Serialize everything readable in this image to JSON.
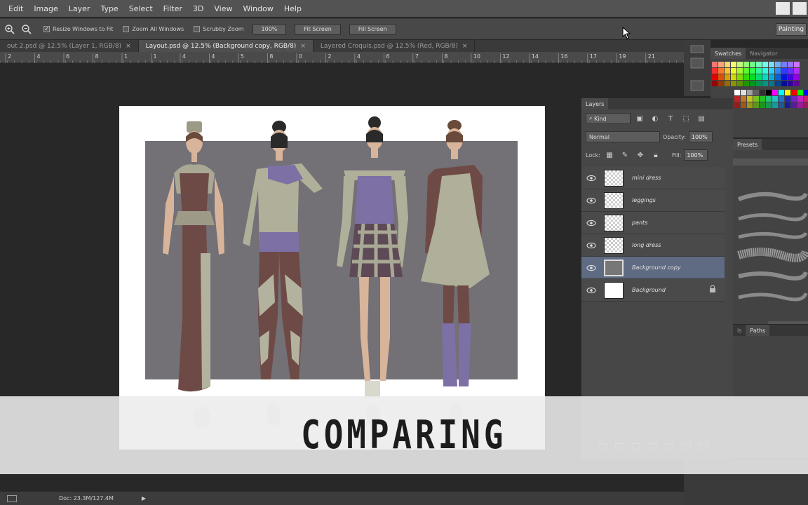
{
  "menu": {
    "items": [
      "Edit",
      "Image",
      "Layer",
      "Type",
      "Select",
      "Filter",
      "3D",
      "View",
      "Window",
      "Help"
    ]
  },
  "options_bar": {
    "resize_windows": "Resize Windows to Fit",
    "zoom_all_windows": "Zoom All Windows",
    "scrubby_zoom": "Scrubby Zoom",
    "btn_100": "100%",
    "btn_fit_screen": "Fit Screen",
    "btn_fill_screen": "Fill Screen",
    "workspace": "Painting"
  },
  "tabs": [
    {
      "label": "out 2.psd @ 12.5% (Layer 1, RGB/8)",
      "active": false
    },
    {
      "label": "Layout.psd @ 12.5% (Background copy, RGB/8)",
      "active": true
    },
    {
      "label": "Layered Croquis.psd @ 12.5% (Red, RGB/8)",
      "active": false
    }
  ],
  "ruler_numbers": [
    "2",
    "4",
    "6",
    "8",
    "1",
    "1",
    "4",
    "4",
    "5",
    "8",
    "0",
    "2",
    "4",
    "6",
    "7",
    "8",
    "10",
    "12",
    "14",
    "16",
    "17",
    "19",
    "21"
  ],
  "swatches_panel": {
    "tabs": [
      "Swatches",
      "Navigator"
    ]
  },
  "presets_panel": {
    "tab": "Presets"
  },
  "paths_panel": {
    "tabs": [
      "ls",
      "Paths"
    ]
  },
  "layers_panel": {
    "tab": "Layers",
    "kind": "Kind",
    "blend_mode": "Normal",
    "opacity_label": "Opacity:",
    "opacity_value": "100%",
    "lock_label": "Lock:",
    "fill_label": "Fill:",
    "fill_value": "100%",
    "layers": [
      {
        "name": "mini dress",
        "selected": false,
        "thumb": "checker"
      },
      {
        "name": "leggings",
        "selected": false,
        "thumb": "checker"
      },
      {
        "name": "pants",
        "selected": false,
        "thumb": "checker"
      },
      {
        "name": "long dress",
        "selected": false,
        "thumb": "checker"
      },
      {
        "name": "Background copy",
        "selected": true,
        "thumb": "gray"
      },
      {
        "name": "Background",
        "selected": false,
        "thumb": "solid"
      }
    ]
  },
  "status_bar": {
    "doc": "Doc: 23.3M/127.4M"
  },
  "caption": "COMPARING",
  "colors": {
    "accent_selected": "#5f6b82",
    "canvas_gray": "#737076"
  }
}
